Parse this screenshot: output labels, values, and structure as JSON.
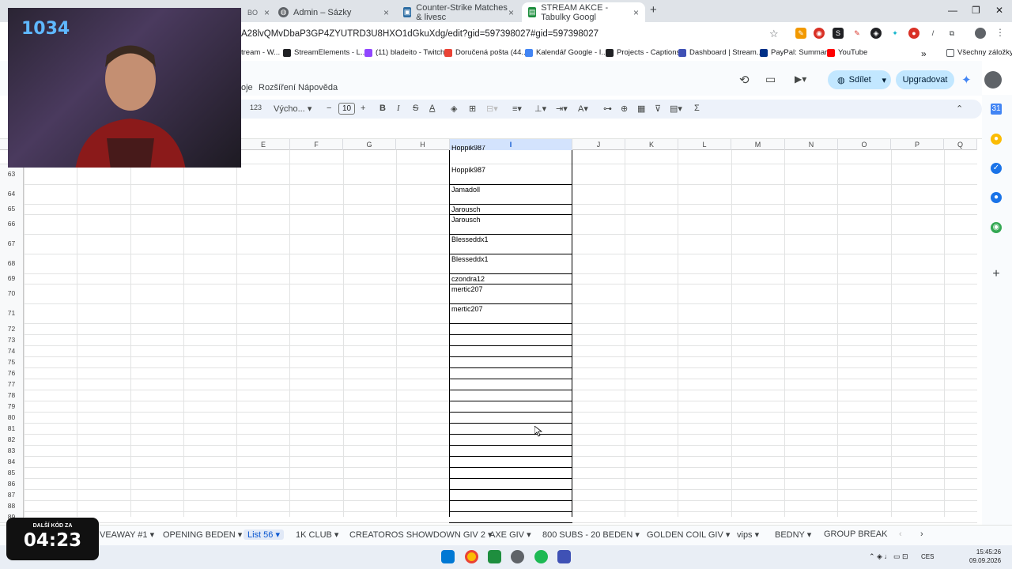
{
  "browser": {
    "tabs": [
      {
        "label": "Admin – Sázky",
        "icon": "globe-icon"
      },
      {
        "label": "Counter-Strike Matches & livesc",
        "icon": "hltv-icon"
      },
      {
        "label": "STREAM AKCE - Tabulky Googl",
        "icon": "sheets-icon"
      }
    ],
    "url": "A28lvQMvDbaP3GP4ZYUTRD3U8HXO1dGkuXdg/edit?gid=597398027#gid=597398027",
    "bookmarks": [
      "tream - W...",
      "StreamElements - L...",
      "(11) bladeito - Twitch",
      "Doručená pošta (44...",
      "Kalendář Google - I...",
      "Projects - Captions",
      "Dashboard | Stream...",
      "PayPal: Summary",
      "YouTube",
      "Všechny záložky"
    ]
  },
  "sheets": {
    "menu": [
      "oje",
      "Rozšíření",
      "Nápověda"
    ],
    "share_label": "Sdílet",
    "upgrade_label": "Upgradovat",
    "toolbar": {
      "format": "123",
      "font": "Výcho...",
      "font_size": "10"
    },
    "columns": [
      "E",
      "F",
      "G",
      "H",
      "I",
      "J",
      "K",
      "L",
      "M",
      "N",
      "O",
      "P",
      "Q"
    ],
    "selected_column": "I",
    "rows": [
      {
        "num": "63",
        "value": "Hoppik987"
      },
      {
        "num": "64",
        "value": "Jamadoll"
      },
      {
        "num": "65",
        "value": "Jarousch"
      },
      {
        "num": "66",
        "value": "Jarousch"
      },
      {
        "num": "67",
        "value": "Blesseddx1"
      },
      {
        "num": "68",
        "value": "Blesseddx1"
      },
      {
        "num": "69",
        "value": "czondra12"
      },
      {
        "num": "70",
        "value": "mertic207"
      },
      {
        "num": "71",
        "value": "mertic207"
      },
      {
        "num": "72",
        "value": ""
      },
      {
        "num": "73",
        "value": ""
      },
      {
        "num": "74",
        "value": ""
      },
      {
        "num": "75",
        "value": ""
      },
      {
        "num": "76",
        "value": ""
      },
      {
        "num": "77",
        "value": ""
      },
      {
        "num": "78",
        "value": ""
      },
      {
        "num": "79",
        "value": ""
      },
      {
        "num": "80",
        "value": ""
      },
      {
        "num": "81",
        "value": ""
      },
      {
        "num": "82",
        "value": ""
      },
      {
        "num": "83",
        "value": ""
      },
      {
        "num": "84",
        "value": ""
      },
      {
        "num": "85",
        "value": ""
      },
      {
        "num": "86",
        "value": ""
      },
      {
        "num": "87",
        "value": ""
      },
      {
        "num": "88",
        "value": ""
      },
      {
        "num": "89",
        "value": ""
      }
    ],
    "top_partial_value": "Hoppik987",
    "sheet_tabs": [
      "VEAWAY #1",
      "OPENING BEDEN",
      "List 56",
      "1K CLUB",
      "CREATOROS SHOWDOWN GIV 2",
      "AXE GIV",
      "800 SUBS - 20 BEDEN",
      "GOLDEN COIL GIV",
      "vips",
      "BEDNY",
      "GROUP BREAK SU"
    ],
    "active_sheet": "List 56"
  },
  "overlay": {
    "webcam_count": "1034",
    "timer_label": "DALŠÍ KÓD ZA",
    "timer_value": "04:23"
  },
  "taskbar": {
    "lang": "CES",
    "time": "15:45:26",
    "date": "09.09.2026"
  },
  "colors": {
    "accent": "#0b57d0",
    "share_bg": "#c2e7ff",
    "selected_col": "#d3e3fd"
  }
}
